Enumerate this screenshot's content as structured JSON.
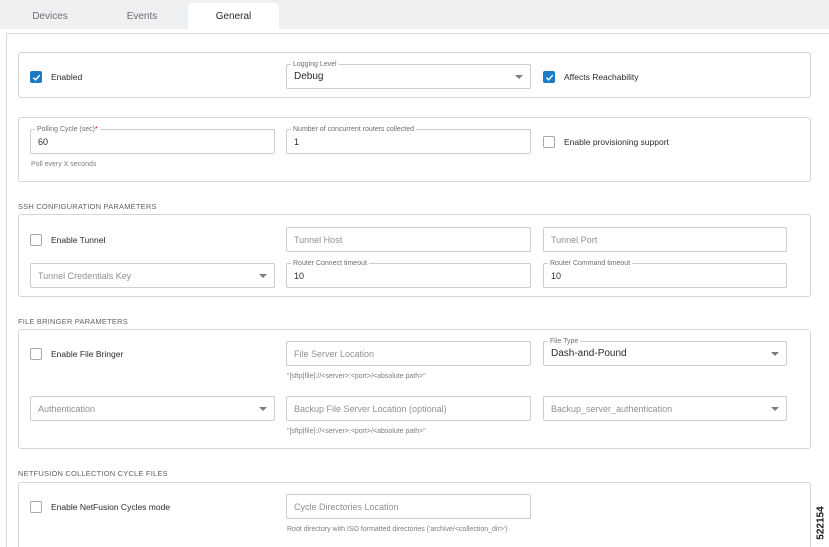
{
  "tabs": [
    {
      "label": "Devices"
    },
    {
      "label": "Events"
    },
    {
      "label": "General",
      "active": true
    }
  ],
  "general": {
    "enabled_label": "Enabled",
    "enabled_checked": true,
    "logging_level": {
      "label": "Logging Level",
      "value": "Debug"
    },
    "affects_reachability_label": "Affects Reachability",
    "affects_reachability_checked": true
  },
  "polling": {
    "label": "Polling Cycle (sec)",
    "required_mark": "*",
    "value": "60",
    "helper": "Poll every X seconds",
    "concurrent_label": "Number of concurrent routers collected",
    "concurrent_value": "1",
    "provisioning_label": "Enable provisioning support",
    "provisioning_checked": false
  },
  "ssh": {
    "title": "SSH CONFIGURATION PARAMETERS",
    "enable_tunnel_label": "Enable Tunnel",
    "tunnel_host_placeholder": "Tunnel Host",
    "tunnel_port_placeholder": "Tunnel Port",
    "credentials_placeholder": "Tunnel Credentials Key",
    "connect_timeout_label": "Router Connect timeout",
    "connect_timeout_value": "10",
    "command_timeout_label": "Router Command timeout",
    "command_timeout_value": "10"
  },
  "file_bringer": {
    "title": "FILE BRINGER PARAMETERS",
    "enable_label": "Enable File Bringer",
    "server_location_placeholder": "File Server Location",
    "server_location_helper": "\"[sftp|file]://<server>:<port>/<absolute path>\"",
    "file_type": {
      "label": "File Type",
      "value": "Dash-and-Pound"
    },
    "authentication_placeholder": "Authentication",
    "backup_location_placeholder": "Backup File Server Location (optional)",
    "backup_location_helper": "\"[sftp|file]://<server>:<port>/<absolute path>\"",
    "backup_auth_placeholder": "Backup_server_authentication"
  },
  "netfusion": {
    "title": "NETFUSION COLLECTION CYCLE FILES",
    "enable_label": "Enable NetFusion Cycles mode",
    "cycle_dirs_placeholder": "Cycle Directories Location",
    "cycle_dirs_helper": "Root directory with ISO formatted directories ('archive/<collection_dir>')"
  },
  "figure_number": "522154",
  "colors": {
    "accent": "#1c7bc6",
    "border": "#d3d6d9",
    "tabbar": "#eef0f2"
  }
}
